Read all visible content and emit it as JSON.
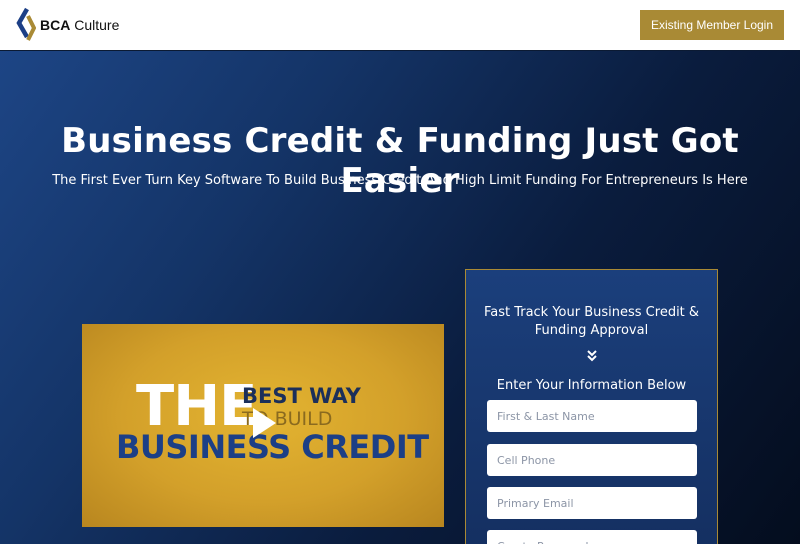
{
  "brand": {
    "name_bold": "BCA",
    "name_rest": " Culture",
    "colors": {
      "gold": "#a98a35",
      "navy": "#143467"
    }
  },
  "header": {
    "login_label": "Existing Member Login"
  },
  "hero": {
    "title": "Business Credit & Funding Just Got Easier",
    "subtitle": "The First Ever Turn Key Software To Build Business Credit And High Limit Funding For Entrepreneurs Is Here"
  },
  "video": {
    "line_the": "THE",
    "line_best": "BEST WAY",
    "line_build": "TO BUILD",
    "line_bc": "BUSINESS CREDIT",
    "icon": "play-icon"
  },
  "form": {
    "title": "Fast Track Your Business Credit & Funding Approval",
    "subtitle": "Enter Your Information Below",
    "fields": [
      {
        "placeholder": "First & Last Name"
      },
      {
        "placeholder": "Cell Phone"
      },
      {
        "placeholder": "Primary Email"
      },
      {
        "placeholder": "Create Password"
      }
    ]
  }
}
